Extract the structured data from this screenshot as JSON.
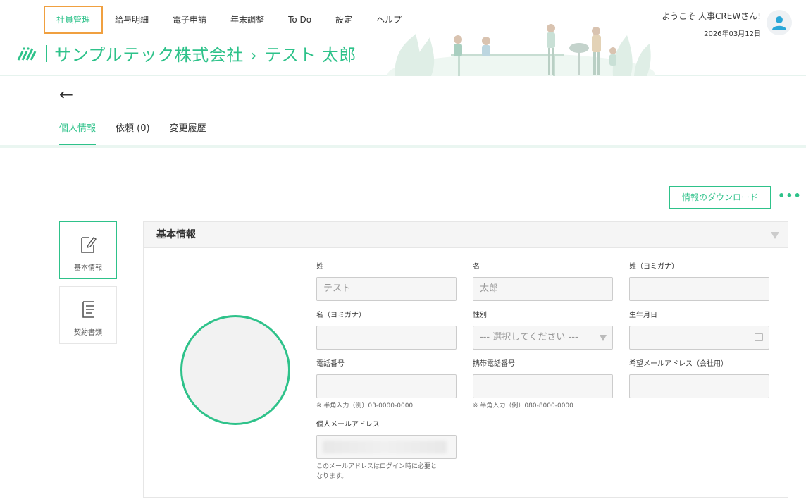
{
  "nav": {
    "items": [
      {
        "label": "社員管理",
        "active": true
      },
      {
        "label": "給与明細"
      },
      {
        "label": "電子申請"
      },
      {
        "label": "年末調整"
      },
      {
        "label": "To Do"
      },
      {
        "label": "設定"
      },
      {
        "label": "ヘルプ"
      }
    ]
  },
  "user": {
    "welcome": "ようこそ 人事CREWさん!",
    "date": "2026年03月12日"
  },
  "header": {
    "company": "サンプルテック株式会社",
    "separator": "›",
    "employee": "テスト 太郎"
  },
  "tabs": [
    {
      "label": "個人情報",
      "active": true
    },
    {
      "label": "依頼 (0)"
    },
    {
      "label": "変更履歴"
    }
  ],
  "actions": {
    "download": "情報のダウンロード",
    "more": "•••"
  },
  "side": [
    {
      "label": "基本情報",
      "icon": "edit-document-icon",
      "active": true
    },
    {
      "label": "契約書類",
      "icon": "document-list-icon"
    }
  ],
  "section": {
    "title": "基本情報"
  },
  "fields": {
    "last_name": {
      "label": "姓",
      "value": "テスト"
    },
    "first_name": {
      "label": "名",
      "value": "太郎"
    },
    "last_kana": {
      "label": "姓（ヨミガナ）",
      "value": ""
    },
    "first_kana": {
      "label": "名（ヨミガナ）",
      "value": ""
    },
    "gender": {
      "label": "性別",
      "value": "--- 選択してください ---"
    },
    "birthdate": {
      "label": "生年月日",
      "value": ""
    },
    "phone": {
      "label": "電話番号",
      "value": "",
      "hint": "※ 半角入力（例）03-0000-0000"
    },
    "mobile": {
      "label": "携帯電話番号",
      "value": "",
      "hint": "※ 半角入力（例）080-8000-0000"
    },
    "work_email": {
      "label": "希望メールアドレス（会社用）",
      "value": ""
    },
    "personal_email": {
      "label": "個人メールアドレス",
      "value": "",
      "hint": "このメールアドレスはログイン時に必要となります。"
    }
  },
  "colors": {
    "accent": "#2ec28a",
    "highlight": "#f0a040"
  }
}
